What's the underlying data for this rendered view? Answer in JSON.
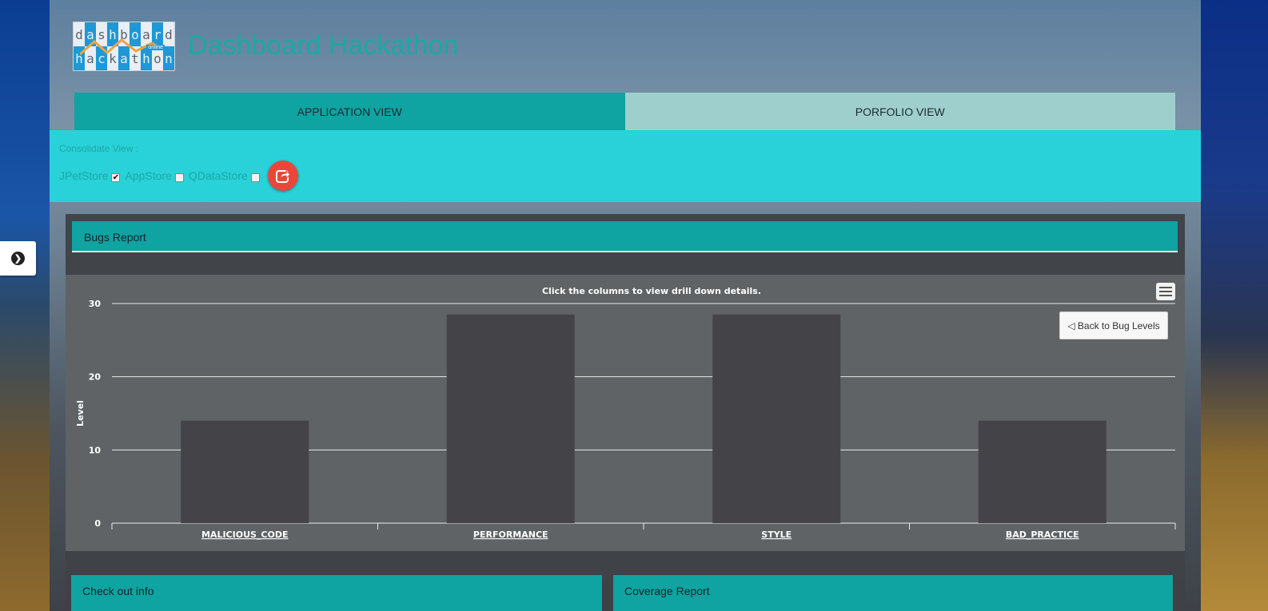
{
  "app": {
    "title": "Dashboard Hackathon",
    "logo_top": [
      "d",
      "a",
      "s",
      "h",
      "b",
      "o",
      "a",
      "r",
      "d"
    ],
    "logo_bottom": [
      "h",
      "a",
      "c",
      "k",
      "a",
      "t",
      "h",
      "o",
      "n"
    ],
    "logo_tag": "online"
  },
  "tabs": [
    {
      "label": "APPLICATION VIEW",
      "active": true
    },
    {
      "label": "PORFOLIO VIEW",
      "active": false
    }
  ],
  "consolidate": {
    "label": "Consolidate View :",
    "options": [
      {
        "label": "JPetStore",
        "checked": true
      },
      {
        "label": "AppStore",
        "checked": false
      },
      {
        "label": "QDataStore",
        "checked": false
      }
    ],
    "go_icon": "share-arrow-icon"
  },
  "bugs_panel": {
    "title": "Bugs Report",
    "back_label": "◁ Back to Bug Levels",
    "menu_icon": "hamburger-menu-icon"
  },
  "chart_data": {
    "type": "bar",
    "title": "Click the columns to view drill down details.",
    "categories": [
      "MALICIOUS_CODE",
      "PERFORMANCE",
      "STYLE",
      "BAD_PRACTICE"
    ],
    "values": [
      14,
      28.5,
      28.5,
      14
    ],
    "ylabel": "Level",
    "xlabel": "",
    "ylim": [
      0,
      30
    ],
    "yticks": [
      0,
      10,
      20,
      30
    ],
    "grid": true,
    "colors": {
      "bar": "#434348",
      "grid": "#e8e8e8",
      "text": "#ffffff"
    }
  },
  "cards": [
    {
      "title": "Check out info"
    },
    {
      "title": "Coverage Report"
    }
  ],
  "side_toggle_icon": "chevron-right-circle-icon"
}
